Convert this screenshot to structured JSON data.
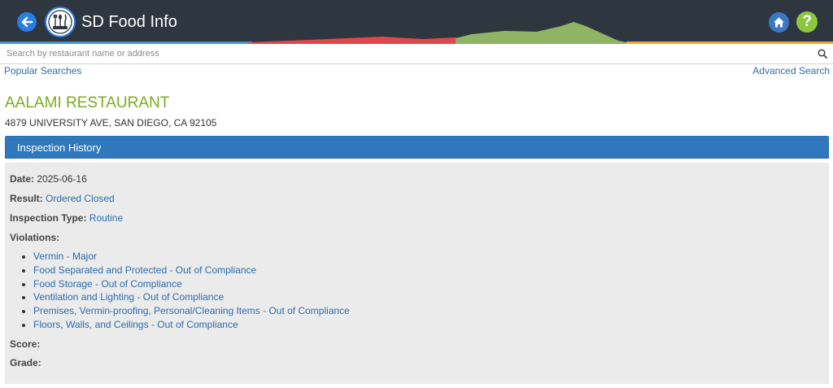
{
  "header": {
    "title": "SD Food Info",
    "help_label": "?",
    "colors": {
      "bg": "#2e3640",
      "back": "#2a7de1",
      "home": "#3a78c5",
      "help": "#8cc63f"
    }
  },
  "search": {
    "placeholder": "Search by restaurant name or address",
    "value": ""
  },
  "links": {
    "popular": "Popular Searches",
    "advanced": "Advanced Search"
  },
  "restaurant": {
    "name": "AALAMI RESTAURANT",
    "address": "4879 UNIVERSITY AVE, SAN DIEGO, CA 92105"
  },
  "panel": {
    "title": "Inspection History"
  },
  "inspection": {
    "date_label": "Date:",
    "date": "2025-06-16",
    "result_label": "Result:",
    "result": "Ordered Closed",
    "type_label": "Inspection Type:",
    "type": "Routine",
    "violations_label": "Violations:",
    "violations": [
      "Vermin - Major",
      "Food Separated and Protected - Out of Compliance",
      "Food Storage - Out of Compliance",
      "Ventilation and Lighting - Out of Compliance",
      "Premises, Vermin-proofing, Personal/Cleaning Items - Out of Compliance",
      "Floors, Walls, and Ceilings - Out of Compliance"
    ],
    "score_label": "Score:",
    "score": "",
    "grade_label": "Grade:",
    "grade": ""
  }
}
